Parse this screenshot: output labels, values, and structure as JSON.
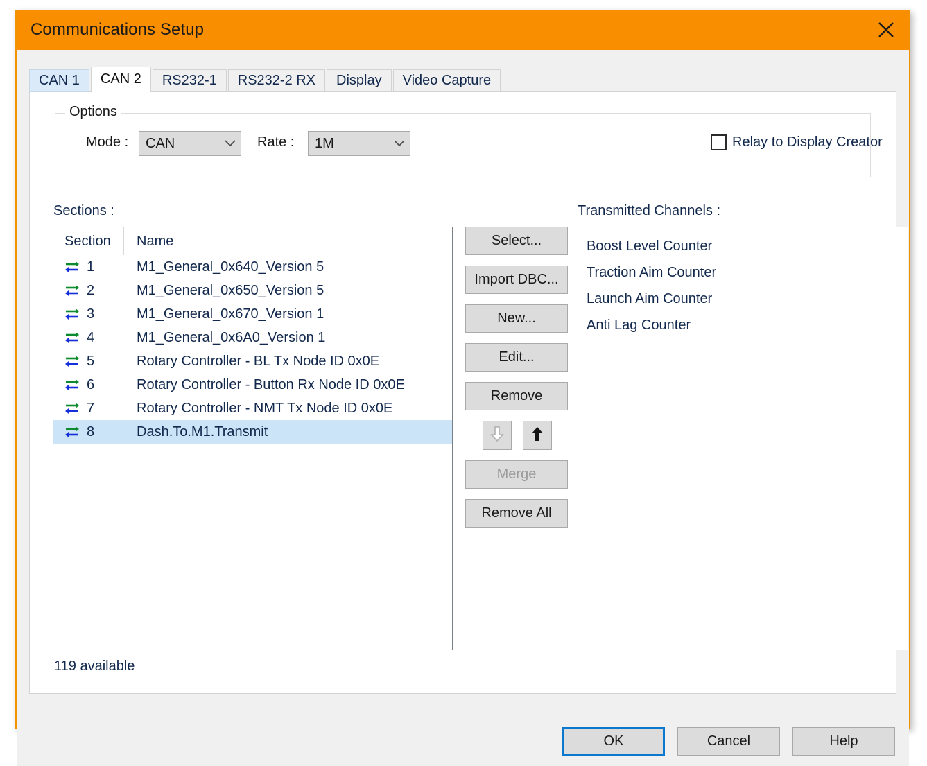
{
  "window": {
    "title": "Communications Setup",
    "close_icon": "close-icon",
    "accent_color": "#f98e00",
    "border_color": "#f39200"
  },
  "tabs": [
    {
      "label": "CAN 1",
      "state": "hovered"
    },
    {
      "label": "CAN 2",
      "state": "selected"
    },
    {
      "label": "RS232-1",
      "state": "normal"
    },
    {
      "label": "RS232-2 RX",
      "state": "normal"
    },
    {
      "label": "Display",
      "state": "normal"
    },
    {
      "label": "Video Capture",
      "state": "normal"
    }
  ],
  "options": {
    "legend": "Options",
    "mode_label": "Mode :",
    "mode_value": "CAN",
    "rate_label": "Rate :",
    "rate_value": "1M",
    "relay_label": "Relay to Display Creator",
    "relay_checked": false,
    "dropdown_icon": "chevron-down-icon"
  },
  "sections_panel": {
    "caption": "Sections :",
    "columns": [
      "Section",
      "Name"
    ],
    "row_icon": "exchange-arrows-icon",
    "rows": [
      {
        "section": "1",
        "name": "M1_General_0x640_Version 5",
        "selected": false
      },
      {
        "section": "2",
        "name": "M1_General_0x650_Version 5",
        "selected": false
      },
      {
        "section": "3",
        "name": "M1_General_0x670_Version 1",
        "selected": false
      },
      {
        "section": "4",
        "name": "M1_General_0x6A0_Version 1",
        "selected": false
      },
      {
        "section": "5",
        "name": "Rotary Controller - BL Tx Node ID 0x0E",
        "selected": false
      },
      {
        "section": "6",
        "name": "Rotary Controller - Button Rx Node ID 0x0E",
        "selected": false
      },
      {
        "section": "7",
        "name": "Rotary Controller - NMT Tx Node ID 0x0E",
        "selected": false
      },
      {
        "section": "8",
        "name": "Dash.To.M1.Transmit",
        "selected": true
      }
    ],
    "available_text": "119 available",
    "selection_color": "#cce4f7"
  },
  "actions": {
    "select": "Select...",
    "import_dbc": "Import DBC...",
    "new": "New...",
    "edit": "Edit...",
    "remove": "Remove",
    "move_down_icon": "arrow-down-icon",
    "move_up_icon": "arrow-up-icon",
    "move_down_enabled": false,
    "move_up_enabled": true,
    "merge": "Merge",
    "merge_enabled": false,
    "remove_all": "Remove All"
  },
  "channels_panel": {
    "caption": "Transmitted Channels :",
    "items": [
      "Boost Level Counter",
      "Traction Aim Counter",
      "Launch Aim Counter",
      "Anti Lag Counter"
    ]
  },
  "footer": {
    "ok": "OK",
    "cancel": "Cancel",
    "help": "Help",
    "default_button_color": "#0b78d0"
  }
}
